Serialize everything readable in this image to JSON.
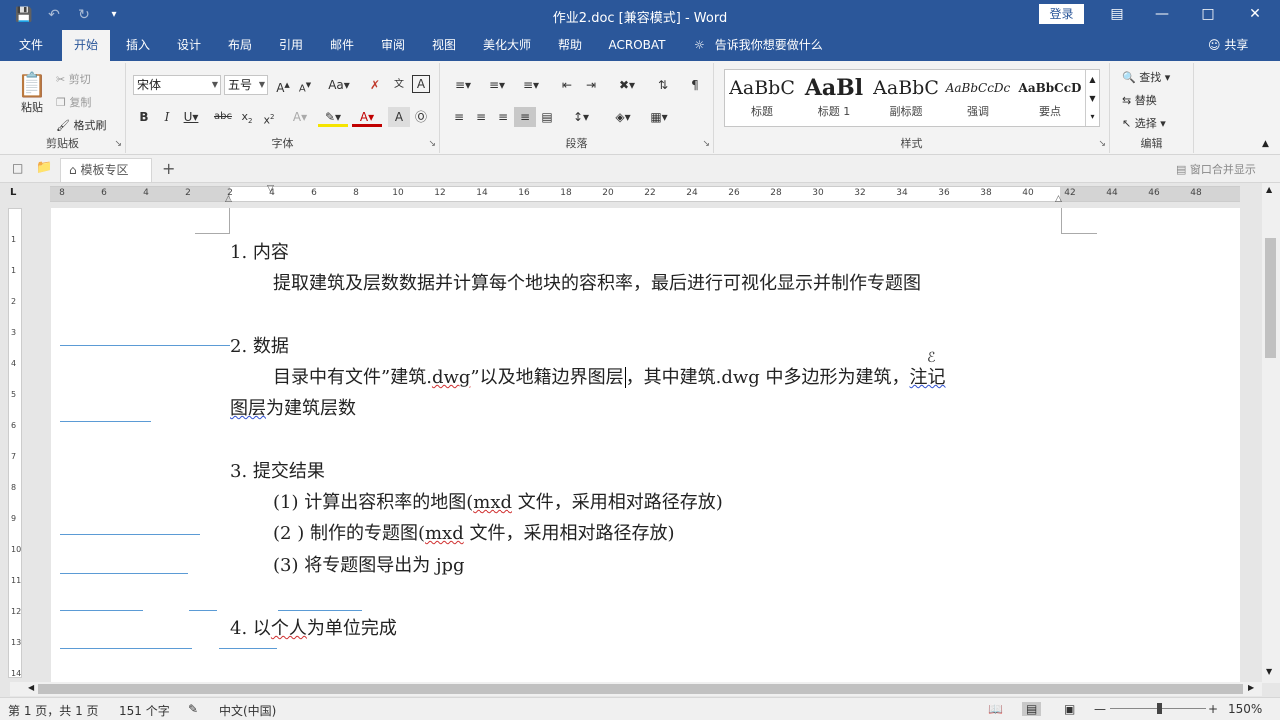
{
  "window": {
    "title": "作业2.doc [兼容模式]  -  Word",
    "login_label": "登录"
  },
  "tabs": [
    "文件",
    "开始",
    "插入",
    "设计",
    "布局",
    "引用",
    "邮件",
    "审阅",
    "视图",
    "美化大师",
    "帮助",
    "ACROBAT"
  ],
  "active_tab": "开始",
  "tellme": "告诉我你想要做什么",
  "share": "共享",
  "ribbon": {
    "clipboard": {
      "label": "剪贴板",
      "paste": "粘贴",
      "cut": "剪切",
      "copy": "复制",
      "format_painter": "格式刷"
    },
    "font": {
      "label": "字体",
      "font_name": "宋体",
      "font_size": "五号"
    },
    "paragraph": {
      "label": "段落"
    },
    "styles": {
      "label": "样式",
      "items": [
        {
          "preview": "AaBbC",
          "name": "标题"
        },
        {
          "preview": "AaBl",
          "name": "标题 1"
        },
        {
          "preview": "AaBbC",
          "name": "副标题"
        },
        {
          "preview": "AaBbCcDc",
          "name": "强调"
        },
        {
          "preview": "AaBbCcD",
          "name": "要点"
        }
      ]
    },
    "editing": {
      "label": "编辑",
      "find": "查找",
      "replace": "替换",
      "select": "选择"
    }
  },
  "tabstrip": {
    "doc_tab": "模板专区",
    "merge": "窗口合并显示"
  },
  "ruler": {
    "h_numbers": [
      "8",
      "6",
      "4",
      "2",
      "2",
      "4",
      "6",
      "8",
      "10",
      "12",
      "14",
      "16",
      "18",
      "20",
      "22",
      "24",
      "26",
      "28",
      "30",
      "32",
      "34",
      "36",
      "38",
      "40",
      "42",
      "44",
      "46",
      "48"
    ],
    "v_numbers": [
      "1",
      "1",
      "2",
      "3",
      "4",
      "5",
      "6",
      "7",
      "8",
      "9",
      "10",
      "11",
      "12",
      "13",
      "14"
    ]
  },
  "document": {
    "s1_heading": "1.  内容",
    "s1_body": "提取建筑及层数数据并计算每个地块的容积率，最后进行可视化显示并制作专题图",
    "s2_heading": "2.  数据",
    "s2_line1_a": "目录中有文件”建筑.",
    "s2_line1_b": "dwg",
    "s2_line1_c": "”以及地籍边界图层",
    "s2_line1_d": "，其中建筑.dwg  中多边形为建筑，",
    "s2_line1_e": "注记",
    "s2_line2_a": "图层",
    "s2_line2_b": "为建筑层数",
    "s3_heading": "3.  提交结果",
    "s3_item1_a": "(1)  计算出容积率的地图(",
    "s3_item1_b": "mxd",
    "s3_item1_c": " 文件，采用相对路径存放)",
    "s3_item2_a": "(2 )  制作的专题图(",
    "s3_item2_b": "mxd",
    "s3_item2_c": " 文件，采用相对路径存放)",
    "s3_item3": "(3)  将专题图导出为 jpg",
    "s4_heading_a": "4.  以",
    "s4_heading_b": "个人",
    "s4_heading_c": "为单位完成"
  },
  "status": {
    "page": "第 1 页，共 1 页",
    "words": "151 个字",
    "language": "中文(中国)",
    "zoom": "150%"
  }
}
